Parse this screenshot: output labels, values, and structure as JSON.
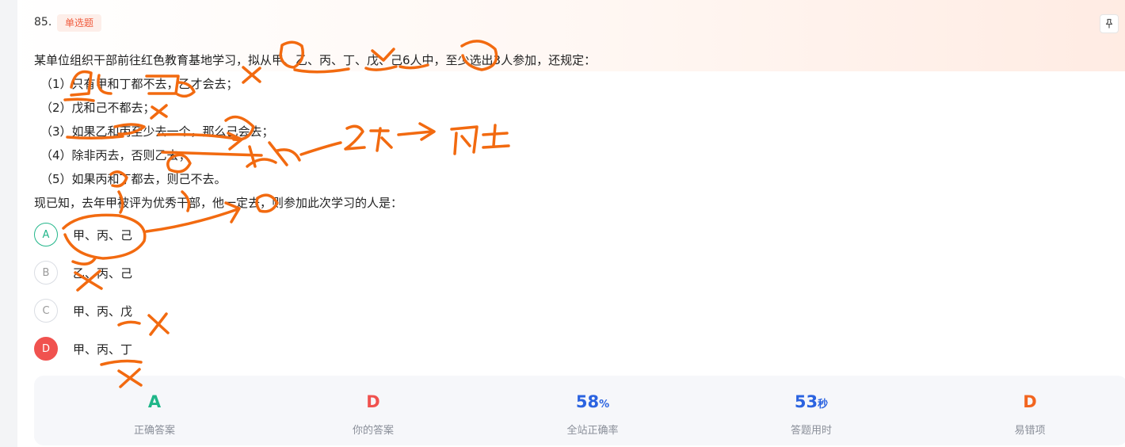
{
  "question": {
    "number": "85.",
    "type_tag": "单选题",
    "intro": "某单位组织干部前往红色教育基地学习，拟从甲、乙、丙、丁、戊、己6人中，至少选出3人参加，还规定：",
    "conditions": [
      "（1）只有甲和丁都不去，乙才会去；",
      "（2）戊和己不都去；",
      "（3）如果乙和丙至少去一个，那么己会去；",
      "（4）除非丙去，否则乙去；",
      "（5）如果丙和丁都去，则己不去。"
    ],
    "prompt": "现已知，去年甲被评为优秀干部，他一定去，则参加此次学习的人是："
  },
  "options": [
    {
      "letter": "A",
      "text": "甲、丙、己",
      "state": "correct"
    },
    {
      "letter": "B",
      "text": "乙、丙、己",
      "state": "neutral"
    },
    {
      "letter": "C",
      "text": "甲、丙、戊",
      "state": "neutral"
    },
    {
      "letter": "D",
      "text": "甲、丙、丁",
      "state": "selected-wrong"
    }
  ],
  "stats": [
    {
      "value": "A",
      "unit": "",
      "label": "正确答案",
      "color": "#1fb688"
    },
    {
      "value": "D",
      "unit": "",
      "label": "你的答案",
      "color": "#f0524f"
    },
    {
      "value": "58",
      "unit": "%",
      "label": "全站正确率",
      "color": "#2b63e0"
    },
    {
      "value": "53",
      "unit": "秒",
      "label": "答题用时",
      "color": "#2b63e0"
    },
    {
      "value": "D",
      "unit": "",
      "label": "易错项",
      "color": "#f2651f"
    }
  ],
  "annotation": {
    "color": "#f26a10",
    "handwritten_notes": [
      "2不",
      "丙去",
      "推论"
    ]
  },
  "icons": {
    "pin": "pin-icon"
  }
}
